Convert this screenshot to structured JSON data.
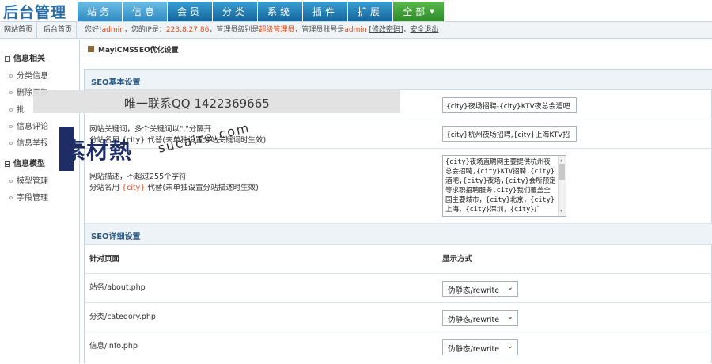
{
  "app": {
    "logo": "后台管理"
  },
  "nav": [
    {
      "label": "站务",
      "active": true
    },
    {
      "label": "信息",
      "active": true
    },
    {
      "label": "会员"
    },
    {
      "label": "分类"
    },
    {
      "label": "系统"
    },
    {
      "label": "插件"
    },
    {
      "label": "扩展"
    },
    {
      "label": "全部",
      "highlight": "green"
    }
  ],
  "subbar": {
    "tab1": "网站首页",
    "tab2": "后台首页",
    "hello": "您好!",
    "user": "admin",
    "ip_label": "，您的IP是：",
    "ip": "223.8.27.86",
    "level_label": "，管理员级别是",
    "level": "超级管理员",
    "account_label": "，管理员账号是",
    "account": "admin",
    "change_pwd": "[修改密码]",
    "logout": "安全退出"
  },
  "sidebar": {
    "group1": "信息相关",
    "items1": [
      "分类信息",
      "删除更复",
      "批",
      "信息评论",
      "信息举报"
    ],
    "group2": "信息模型",
    "items2": [
      "模型管理",
      "字段管理"
    ]
  },
  "breadcrumb": "MaylCMSSEO优化设置",
  "seo_basic": {
    "title": "SEO基本设置",
    "title_input": "{city}夜场招聘-{city}KTV夜总会酒吧",
    "kw_label_1": "网站关键词，多个关键词以\",\"分隔开",
    "kw_label_2": "分站名用 {city} 代替(未单独设置分站关键词时生效)",
    "kw_input": "{city}杭州夜场招聘,{city}上海KTV招",
    "desc_label_1": "网站描述，不超过255个字符",
    "desc_label_2a": "分站名用",
    "desc_label_city": "{city}",
    "desc_label_2b": "代替(未单独设置分站描述时生效)",
    "desc_text": "{city}夜场直聘网主要提供杭州夜总会招聘,{city}KTV招聘,{city}酒吧,{city}夜场,{city}会所预定等求职招聘服务,city}我们覆盖全国主要城市，{city}北京，{city}上海，{city}深圳，{city}广"
  },
  "seo_detail": {
    "title": "SEO详细设置",
    "col_page": "针对页面",
    "col_mode": "显示方式",
    "rows": [
      {
        "page": "站务/about.php",
        "mode": "伪静态/rewrite"
      },
      {
        "page": "分类/category.php",
        "mode": "伪静态/rewrite"
      },
      {
        "page": "信息/info.php",
        "mode": "伪静态/rewrite"
      }
    ]
  },
  "watermark": {
    "contact": "唯一联系QQ 1422369665",
    "brand": "素材熱",
    "url": "sucaire.com"
  }
}
